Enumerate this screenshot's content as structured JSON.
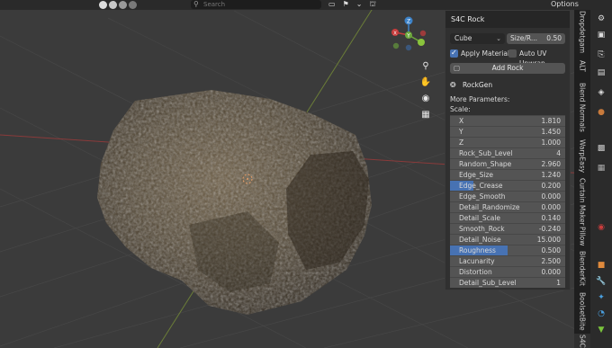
{
  "header": {
    "search_placeholder": "Search",
    "options_label": "Options"
  },
  "icons": {
    "search": "search-icon",
    "hand": "hand-icon",
    "zoom": "zoom-icon",
    "camera": "camera-icon",
    "grid": "grid-icon"
  },
  "gizmo": {
    "x": "X",
    "y": "Y",
    "z": "Z"
  },
  "panel": {
    "title": "S4C Rock",
    "shape_dropdown": "Cube",
    "size_label": "Size/R...",
    "size_value": "0.50",
    "apply_material": "Apply Material",
    "auto_uv": "Auto UV Unwrap",
    "add_rock": "Add Rock",
    "rockgen": "RockGen",
    "more_params": "More Parameters:",
    "scale_label": "Scale:",
    "params": [
      {
        "name": "X",
        "value": "1.810",
        "highlight": 0
      },
      {
        "name": "Y",
        "value": "1.450",
        "highlight": 0
      },
      {
        "name": "Z",
        "value": "1.000",
        "highlight": 0
      },
      {
        "name": "Rock_Sub_Level",
        "value": "4",
        "highlight": 0
      },
      {
        "name": "Random_Shape",
        "value": "2.960",
        "highlight": 0
      },
      {
        "name": "Edge_Size",
        "value": "1.240",
        "highlight": 0
      },
      {
        "name": "Edge_Crease",
        "value": "0.200",
        "highlight": 0.2
      },
      {
        "name": "Edge_Smooth",
        "value": "0.000",
        "highlight": 0
      },
      {
        "name": "Detail_Randomize",
        "value": "0.000",
        "highlight": 0
      },
      {
        "name": "Detail_Scale",
        "value": "0.140",
        "highlight": 0
      },
      {
        "name": "Smooth_Rock",
        "value": "-0.240",
        "highlight": 0
      },
      {
        "name": "Detail_Noise",
        "value": "15.000",
        "highlight": 0
      },
      {
        "name": "Roughness",
        "value": "0.500",
        "highlight": 0.5
      },
      {
        "name": "Lacunarity",
        "value": "2.500",
        "highlight": 0
      },
      {
        "name": "Distortion",
        "value": "0.000",
        "highlight": 0
      },
      {
        "name": "Detail_Sub_Level",
        "value": "1",
        "highlight": 0
      }
    ]
  },
  "sidetabs": [
    "Dropdetgam",
    "ALT",
    "Blend Normals",
    "WarpEasy",
    "Curtain Maker",
    "Pillow",
    "BlenderKit",
    "BoolsetBite",
    "S4C"
  ]
}
